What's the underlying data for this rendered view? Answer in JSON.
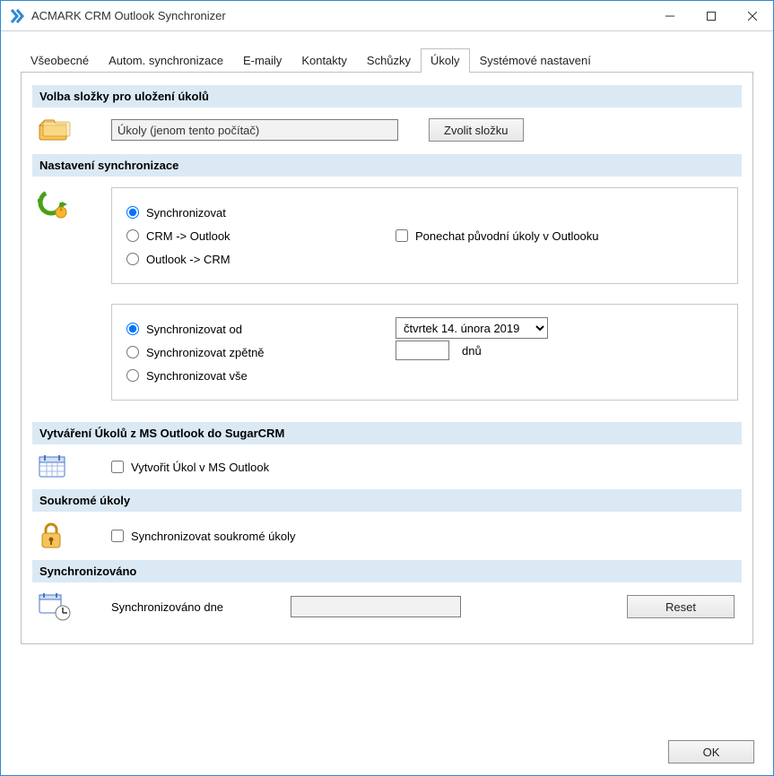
{
  "window": {
    "title": "ACMARK CRM Outlook Synchronizer"
  },
  "tabs": {
    "vseobecne": "Všeobecné",
    "autosync": "Autom. synchronizace",
    "emaily": "E-maily",
    "kontakty": "Kontakty",
    "schuzky": "Schůzky",
    "ukoly": "Úkoly",
    "system": "Systémové nastavení",
    "active": "ukoly"
  },
  "sections": {
    "folder": {
      "title": "Volba složky pro uložení úkolů",
      "value": "Úkoly (jenom tento počítač)",
      "choose_btn": "Zvolit složku"
    },
    "syncsettings": {
      "title": "Nastavení synchronizace",
      "mode": {
        "sync": "Synchronizovat",
        "crm_to_outlook": "CRM -> Outlook",
        "outlook_to_crm": "Outlook -> CRM",
        "selected": "sync"
      },
      "keep_original": "Ponechat původní úkoly v Outlooku",
      "keep_original_checked": false,
      "range": {
        "from": "Synchronizovat od",
        "back": "Synchronizovat zpětně",
        "all": "Synchronizovat vše",
        "selected": "from",
        "date_value": "čtvrtek 14. února 2019",
        "days_value": "",
        "days_unit": "dnů"
      }
    },
    "create": {
      "title": "Vytváření Úkolů z MS Outlook do SugarCRM",
      "checkbox": "Vytvořit Úkol v MS Outlook",
      "checked": false
    },
    "private": {
      "title": "Soukromé úkoly",
      "checkbox": "Synchronizovat soukromé úkoly",
      "checked": false
    },
    "done": {
      "title": "Synchronizováno",
      "label": "Synchronizováno dne",
      "value": "",
      "reset": "Reset"
    }
  },
  "footer": {
    "ok": "OK"
  }
}
